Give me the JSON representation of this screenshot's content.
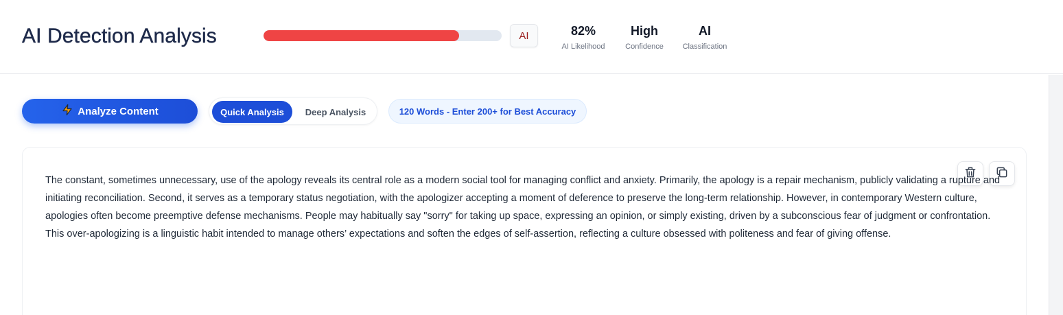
{
  "header": {
    "title": "AI Detection Analysis",
    "progress": {
      "value_percent": 82,
      "color": "#ef4444"
    },
    "tag": "AI",
    "stats": [
      {
        "value": "82%",
        "label": "AI Likelihood"
      },
      {
        "value": "High",
        "label": "Confidence"
      },
      {
        "value": "AI",
        "label": "Classification"
      }
    ]
  },
  "toolbar": {
    "analyze_label": "Analyze Content",
    "analyze_icon": "lightning-icon",
    "modes": [
      {
        "label": "Quick Analysis",
        "active": true
      },
      {
        "label": "Deep Analysis",
        "active": false
      }
    ],
    "word_count_badge": "120 Words - Enter 200+ for Best Accuracy"
  },
  "editor": {
    "text": "The constant, sometimes unnecessary, use of the apology reveals its central role as a modern social tool for managing conflict and anxiety. Primarily, the apology is a repair mechanism, publicly validating a rupture and initiating reconciliation. Second, it serves as a temporary status negotiation, with the apologizer accepting a moment of deference to preserve the long-term relationship. However, in contemporary Western culture, apologies often become preemptive defense mechanisms. People may habitually say \"sorry\" for taking up space, expressing an opinion, or simply existing, driven by a subconscious fear of judgment or confrontation. This over-apologizing is a linguistic habit intended to manage others’ expectations and soften the edges of self-assertion, reflecting a culture obsessed with politeness and fear of giving offense.",
    "actions": [
      {
        "icon": "trash-icon"
      },
      {
        "icon": "copy-icon"
      }
    ]
  },
  "colors": {
    "accent": "#1d4ed8",
    "danger": "#ef4444",
    "title": "#1e2a4a"
  }
}
